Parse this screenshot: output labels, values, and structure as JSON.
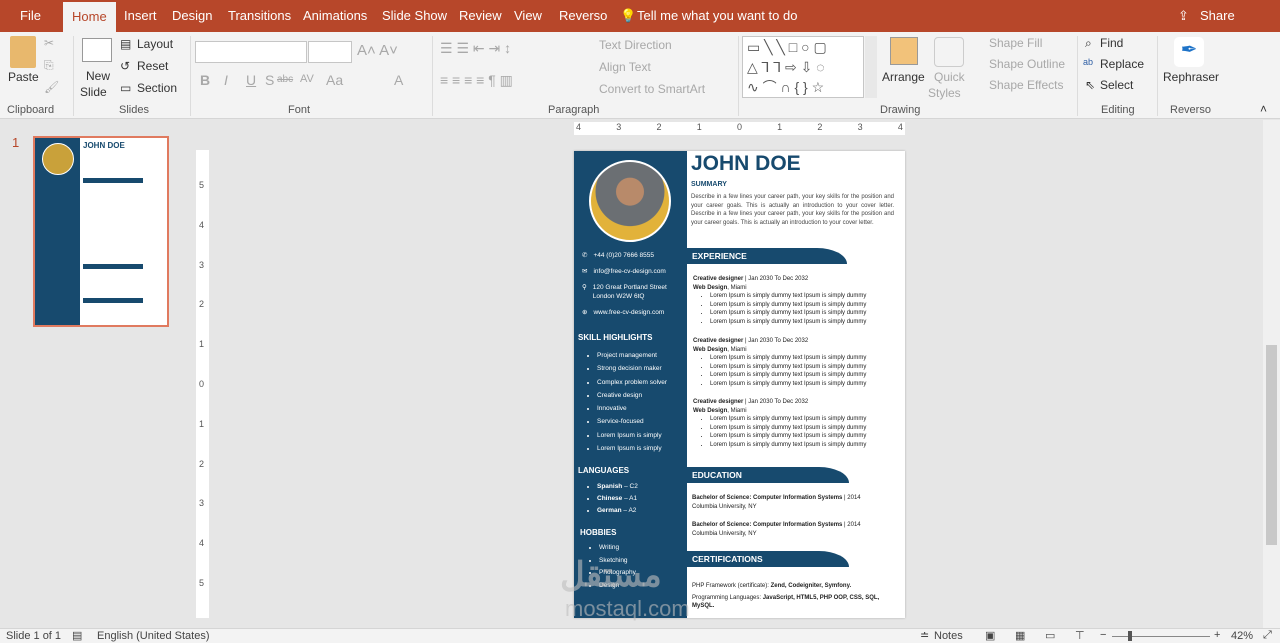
{
  "tabs": [
    "File",
    "Home",
    "Insert",
    "Design",
    "Transitions",
    "Animations",
    "Slide Show",
    "Review",
    "View",
    "Reverso"
  ],
  "tell_me": "Tell me what you want to do",
  "share": "Share",
  "ribbon": {
    "clipboard": {
      "paste": "Paste",
      "label": "Clipboard"
    },
    "slides": {
      "new_slide": "New",
      "new_slide2": "Slide",
      "layout": "Layout",
      "reset": "Reset",
      "section": "Section",
      "label": "Slides"
    },
    "font": {
      "font_name": "",
      "font_size": "",
      "label": "Font",
      "bold": "B",
      "italic": "I",
      "underline": "U",
      "shadow": "S",
      "strike": "abc",
      "spacing": "AV",
      "case": "Aa",
      "color": "A"
    },
    "paragraph": {
      "text_direction": "Text Direction",
      "align_text": "Align Text",
      "smartart": "Convert to SmartArt",
      "label": "Paragraph"
    },
    "drawing": {
      "arrange": "Arrange",
      "quick_styles": "Quick",
      "quick_styles2": "Styles",
      "shape_fill": "Shape Fill",
      "shape_outline": "Shape Outline",
      "shape_effects": "Shape Effects",
      "label": "Drawing"
    },
    "editing": {
      "find": "Find",
      "replace": "Replace",
      "select": "Select",
      "label": "Editing"
    },
    "reverso": {
      "rephraser": "Rephraser",
      "label": "Reverso"
    }
  },
  "thumb_number": "1",
  "ruler_top": [
    "4",
    "3",
    "2",
    "1",
    "0",
    "1",
    "2",
    "3",
    "4"
  ],
  "ruler_left": [
    "5",
    "4",
    "3",
    "2",
    "1",
    "0",
    "1",
    "2",
    "3",
    "4",
    "5"
  ],
  "resume": {
    "name": "JOHN DOE",
    "summary_title": "SUMMARY",
    "summary": "Describe in a few lines your career path, your key skills for the position and your career goals. This is actually an introduction to your cover letter. Describe in a few lines your career path, your key skills for the position and your career goals. This is actually an introduction to your cover letter.",
    "phone": "+44 (0)20 7666 8555",
    "email": "info@free-cv-design.com",
    "address1": "120 Great Portland Street",
    "address2": "London W2W 6tQ",
    "website": "www.free-cv-design.com",
    "skills_title": "SKILL HIGHLIGHTS",
    "skills": [
      "Project management",
      "Strong decision maker",
      "Complex problem solver",
      "Creative design",
      "Innovative",
      "Service-focused",
      "Lorem Ipsum is simply",
      "Lorem Ipsum is simply"
    ],
    "languages_title": "LANGUAGES",
    "languages": [
      {
        "name": "Spanish",
        "level": " – C2"
      },
      {
        "name": "Chinese",
        "level": " – A1"
      },
      {
        "name": "German",
        "level": " – A2"
      }
    ],
    "hobbies_title": "HOBBIES",
    "hobbies": [
      "Writing",
      "Sketching",
      "Photography",
      "Design"
    ],
    "experience_title": "EXPERIENCE",
    "jobs": [
      {
        "role": "Creative designer",
        "dates": " | Jan 2030 To Dec 2032",
        "company": "Web Design",
        "city": ", Miami",
        "bullets": [
          "Lorem Ipsum is simply dummy text Ipsum is simply dummy",
          "Lorem Ipsum is simply dummy text Ipsum is simply dummy",
          "Lorem Ipsum is simply dummy text Ipsum is simply dummy",
          "Lorem Ipsum is simply dummy text Ipsum is simply dummy"
        ]
      },
      {
        "role": "Creative designer",
        "dates": " | Jan 2030 To Dec 2032",
        "company": "Web Design",
        "city": ", Miami",
        "bullets": [
          "Lorem Ipsum is simply dummy text Ipsum is simply dummy",
          "Lorem Ipsum is simply dummy text Ipsum is simply dummy",
          "Lorem Ipsum is simply dummy text Ipsum is simply dummy",
          "Lorem Ipsum is simply dummy text Ipsum is simply dummy"
        ]
      },
      {
        "role": "Creative designer",
        "dates": " | Jan 2030 To Dec 2032",
        "company": "Web Design",
        "city": ", Miami",
        "bullets": [
          "Lorem Ipsum is simply dummy text Ipsum is simply dummy",
          "Lorem Ipsum is simply dummy text Ipsum is simply dummy",
          "Lorem Ipsum is simply dummy text Ipsum is simply dummy",
          "Lorem Ipsum is simply dummy text Ipsum is simply dummy"
        ]
      }
    ],
    "education_title": "EDUCATION",
    "education": [
      {
        "degree": "Bachelor of Science: Computer Information Systems",
        "year": " | 2014",
        "school": "Columbia University, NY"
      },
      {
        "degree": "Bachelor of Science: Computer Information Systems",
        "year": " | 2014",
        "school": "Columbia University, NY"
      }
    ],
    "certifications_title": "CERTIFICATIONS",
    "cert1_label": "PHP Framework (certificate): ",
    "cert1_value": "Zend, Codeigniter, Symfony.",
    "cert2_label": "Programming Languages: ",
    "cert2_value": "JavaScript, HTML5, PHP OOP, CSS, SQL, MySQL."
  },
  "watermark": {
    "arabic": "مستقل",
    "latin": "mostaql.com"
  },
  "status": {
    "slide": "Slide 1 of 1",
    "language": "English (United States)",
    "notes": "Notes",
    "zoom": "42%",
    "zoom_minus": "−",
    "zoom_plus": "+"
  },
  "colors": {
    "accent": "#b7472a",
    "resume_blue": "#174a6e"
  }
}
